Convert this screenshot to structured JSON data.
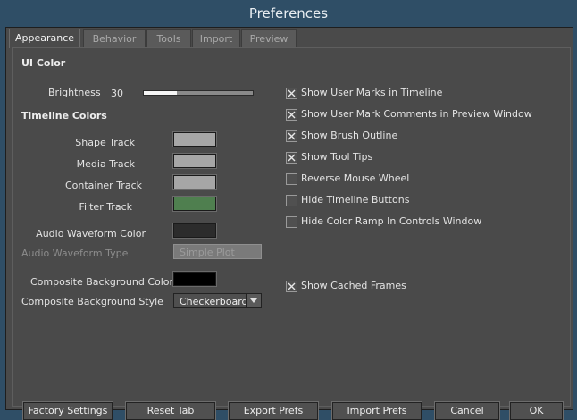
{
  "window": {
    "title": "Preferences"
  },
  "tabs": [
    {
      "label": "Appearance",
      "active": true
    },
    {
      "label": "Behavior",
      "active": false
    },
    {
      "label": "Tools",
      "active": false
    },
    {
      "label": "Import",
      "active": false
    },
    {
      "label": "Preview",
      "active": false
    }
  ],
  "ui_color": {
    "header": "UI Color",
    "brightness_label": "Brightness",
    "brightness_value": "30",
    "brightness_fraction": 0.3
  },
  "timeline_colors": {
    "header": "Timeline Colors",
    "shape_track": {
      "label": "Shape Track",
      "color": "#a6a6a6"
    },
    "media_track": {
      "label": "Media Track",
      "color": "#a6a6a6"
    },
    "container_track": {
      "label": "Container Track",
      "color": "#a6a6a6"
    },
    "filter_track": {
      "label": "Filter Track",
      "color": "#4f7f4f"
    },
    "audio_waveform_color": {
      "label": "Audio Waveform Color",
      "color": "#2c2c2c"
    },
    "audio_waveform_type": {
      "label": "Audio Waveform Type",
      "value": "Simple Plot",
      "disabled": true
    },
    "composite_bg_color": {
      "label": "Composite Background Color",
      "color": "#000000"
    },
    "composite_bg_style": {
      "label": "Composite Background Style",
      "value": "Checkerboard"
    }
  },
  "options": [
    {
      "label": "Show User Marks in Timeline",
      "checked": true
    },
    {
      "label": "Show User Mark Comments in Preview Window",
      "checked": true
    },
    {
      "label": "Show Brush Outline",
      "checked": true
    },
    {
      "label": "Show Tool Tips",
      "checked": true
    },
    {
      "label": "Reverse Mouse Wheel",
      "checked": false
    },
    {
      "label": "Hide Timeline Buttons",
      "checked": false
    },
    {
      "label": "Hide Color Ramp In Controls Window",
      "checked": false
    }
  ],
  "cached_frames": {
    "label": "Show Cached Frames",
    "checked": true
  },
  "buttons": {
    "factory": "Factory Settings",
    "reset": "Reset Tab",
    "export": "Export Prefs",
    "import": "Import Prefs",
    "cancel": "Cancel",
    "ok": "OK"
  },
  "icons": {
    "check": "checkmark-x-icon",
    "dropdown": "chevron-down-icon"
  },
  "colors": {
    "titlebar": "#2f4e66",
    "panel": "#4a4a4a"
  }
}
